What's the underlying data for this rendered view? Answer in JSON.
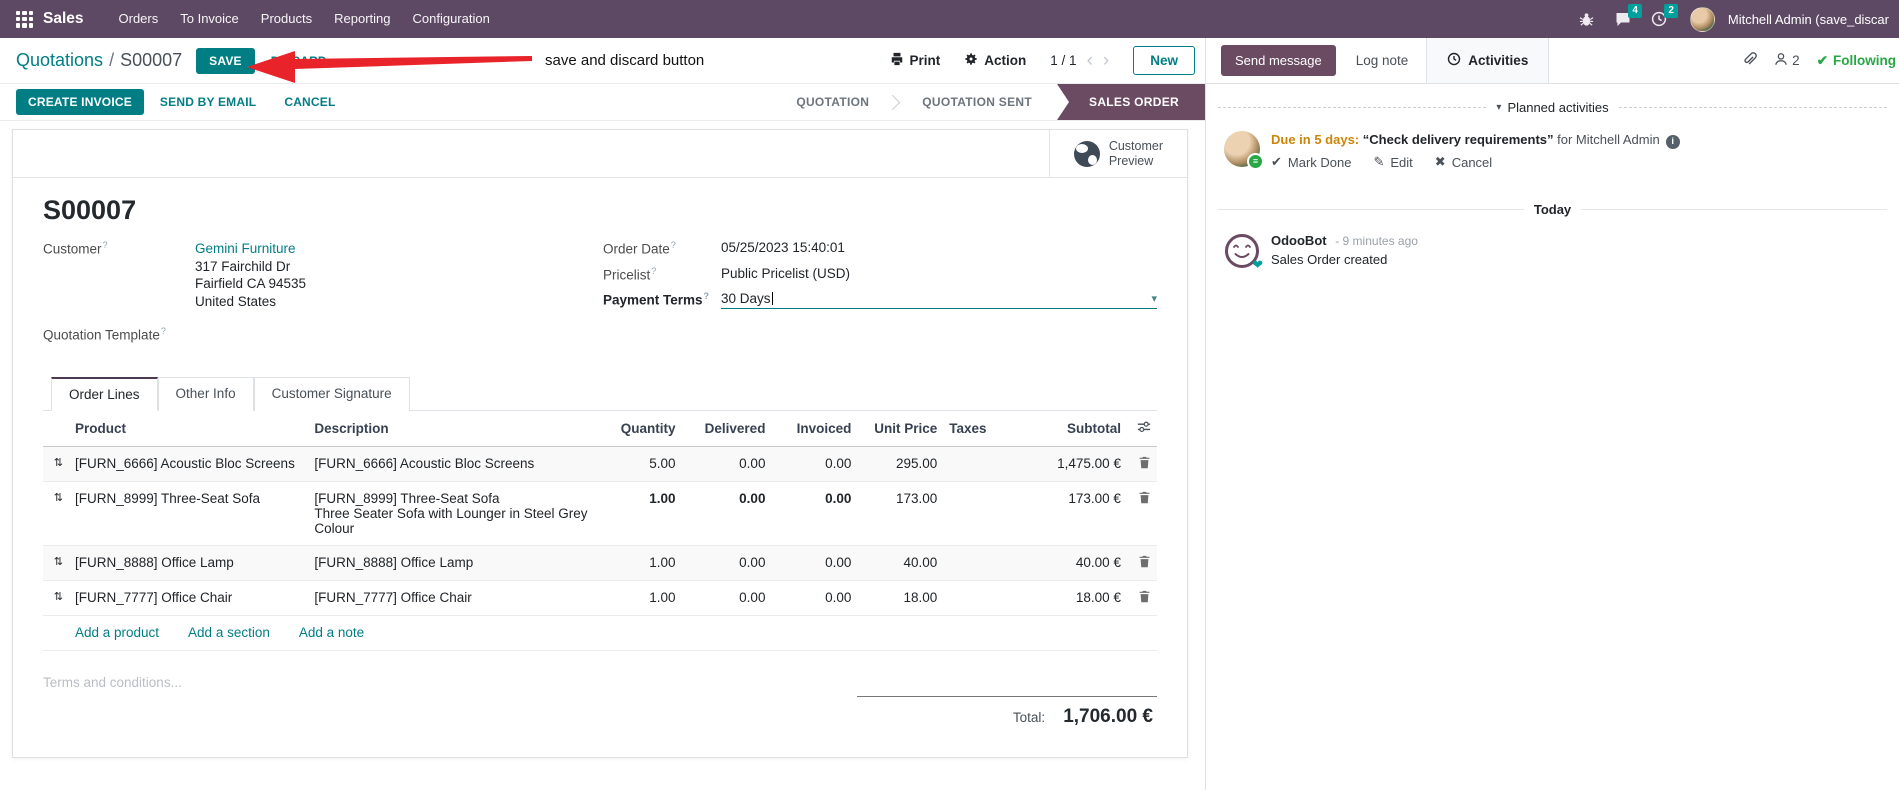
{
  "colors": {
    "nav_purple": "#5e4964",
    "brand_purple": "#6a4b62",
    "accent_teal": "#017e84",
    "badge_teal": "#00a09d",
    "highlight_blue": "#0d8fc0",
    "annotation_red": "#e8232a",
    "due_orange": "#cc8508",
    "following_green": "#28a745"
  },
  "icons": {
    "dropdown_caret": "▾",
    "collapse_caret": "▾",
    "check": "✔",
    "pencil": "✎",
    "x_mark": "✖",
    "info": "i",
    "pager_prev": "‹",
    "pager_next": "›",
    "drag": "⇅",
    "badge_lines": "≡"
  },
  "nav": {
    "app_name": "Sales",
    "items": [
      "Orders",
      "To Invoice",
      "Products",
      "Reporting",
      "Configuration"
    ],
    "messages_badge": "4",
    "activities_badge": "2",
    "user_name": "Mitchell Admin (save_discar"
  },
  "annotation": {
    "text": "save and discard button"
  },
  "control": {
    "breadcrumb_parent": "Quotations",
    "breadcrumb_sep": "/",
    "breadcrumb_current": "S00007",
    "save": "SAVE",
    "discard": "DISCARD",
    "print": "Print",
    "action": "Action",
    "pager": "1 / 1",
    "new": "New"
  },
  "actions": {
    "create_invoice": "CREATE INVOICE",
    "send_by_email": "SEND BY EMAIL",
    "cancel": "CANCEL"
  },
  "statusbar": [
    {
      "label": "QUOTATION"
    },
    {
      "label": "QUOTATION SENT"
    },
    {
      "label": "SALES ORDER"
    }
  ],
  "sheet": {
    "help_marker": "?",
    "preview_line1": "Customer",
    "preview_line2": "Preview",
    "title": "S00007",
    "fields": {
      "customer_label": "Customer",
      "customer_name": "Gemini Furniture",
      "address_line1": "317 Fairchild Dr",
      "address_line2": "Fairfield CA 94535",
      "address_line3": "United States",
      "quotation_template_label": "Quotation Template",
      "order_date_label": "Order Date",
      "order_date": "05/25/2023 15:40:01",
      "pricelist_label": "Pricelist",
      "pricelist": "Public Pricelist (USD)",
      "payment_terms_label": "Payment Terms",
      "payment_terms": "30 Days"
    },
    "tabs": [
      {
        "label": "Order Lines"
      },
      {
        "label": "Other Info"
      },
      {
        "label": "Customer Signature"
      }
    ],
    "table": {
      "headers": [
        "Product",
        "Description",
        "Quantity",
        "Delivered",
        "Invoiced",
        "Unit Price",
        "Taxes",
        "Subtotal"
      ],
      "rows": [
        {
          "product": "[FURN_6666] Acoustic Bloc Screens",
          "description": "[FURN_6666] Acoustic Bloc Screens",
          "description2": "",
          "quantity": "5.00",
          "delivered": "0.00",
          "invoiced": "0.00",
          "unit_price": "295.00",
          "taxes": "",
          "subtotal": "1,475.00 €"
        },
        {
          "product": "[FURN_8999] Three-Seat Sofa",
          "description": "[FURN_8999] Three-Seat Sofa",
          "description2": "Three Seater Sofa with Lounger in Steel Grey Colour",
          "quantity": "1.00",
          "delivered": "0.00",
          "invoiced": "0.00",
          "unit_price": "173.00",
          "taxes": "",
          "subtotal": "173.00 €"
        },
        {
          "product": "[FURN_8888] Office Lamp",
          "description": "[FURN_8888] Office Lamp",
          "description2": "",
          "quantity": "1.00",
          "delivered": "0.00",
          "invoiced": "0.00",
          "unit_price": "40.00",
          "taxes": "",
          "subtotal": "40.00 €"
        },
        {
          "product": "[FURN_7777] Office Chair",
          "description": "[FURN_7777] Office Chair",
          "description2": "",
          "quantity": "1.00",
          "delivered": "0.00",
          "invoiced": "0.00",
          "unit_price": "18.00",
          "taxes": "",
          "subtotal": "18.00 €"
        }
      ],
      "footer_links": [
        "Add a product",
        "Add a section",
        "Add a note"
      ]
    },
    "terms_placeholder": "Terms and conditions...",
    "total_label": "Total:",
    "total_value": "1,706.00 €"
  },
  "chatter": {
    "send_message": "Send message",
    "log_note": "Log note",
    "activities": "Activities",
    "followers_count": "2",
    "following": "Following",
    "planned_title": "Planned activities",
    "activity": {
      "due": "Due in 5 days:",
      "title": "“Check delivery requirements”",
      "for_text": "for Mitchell Admin",
      "mark_done": "Mark Done",
      "edit": "Edit",
      "cancel": "Cancel"
    },
    "today": "Today",
    "message": {
      "author": "OdooBot",
      "time": "- 9 minutes ago",
      "body": "Sales Order created"
    }
  }
}
